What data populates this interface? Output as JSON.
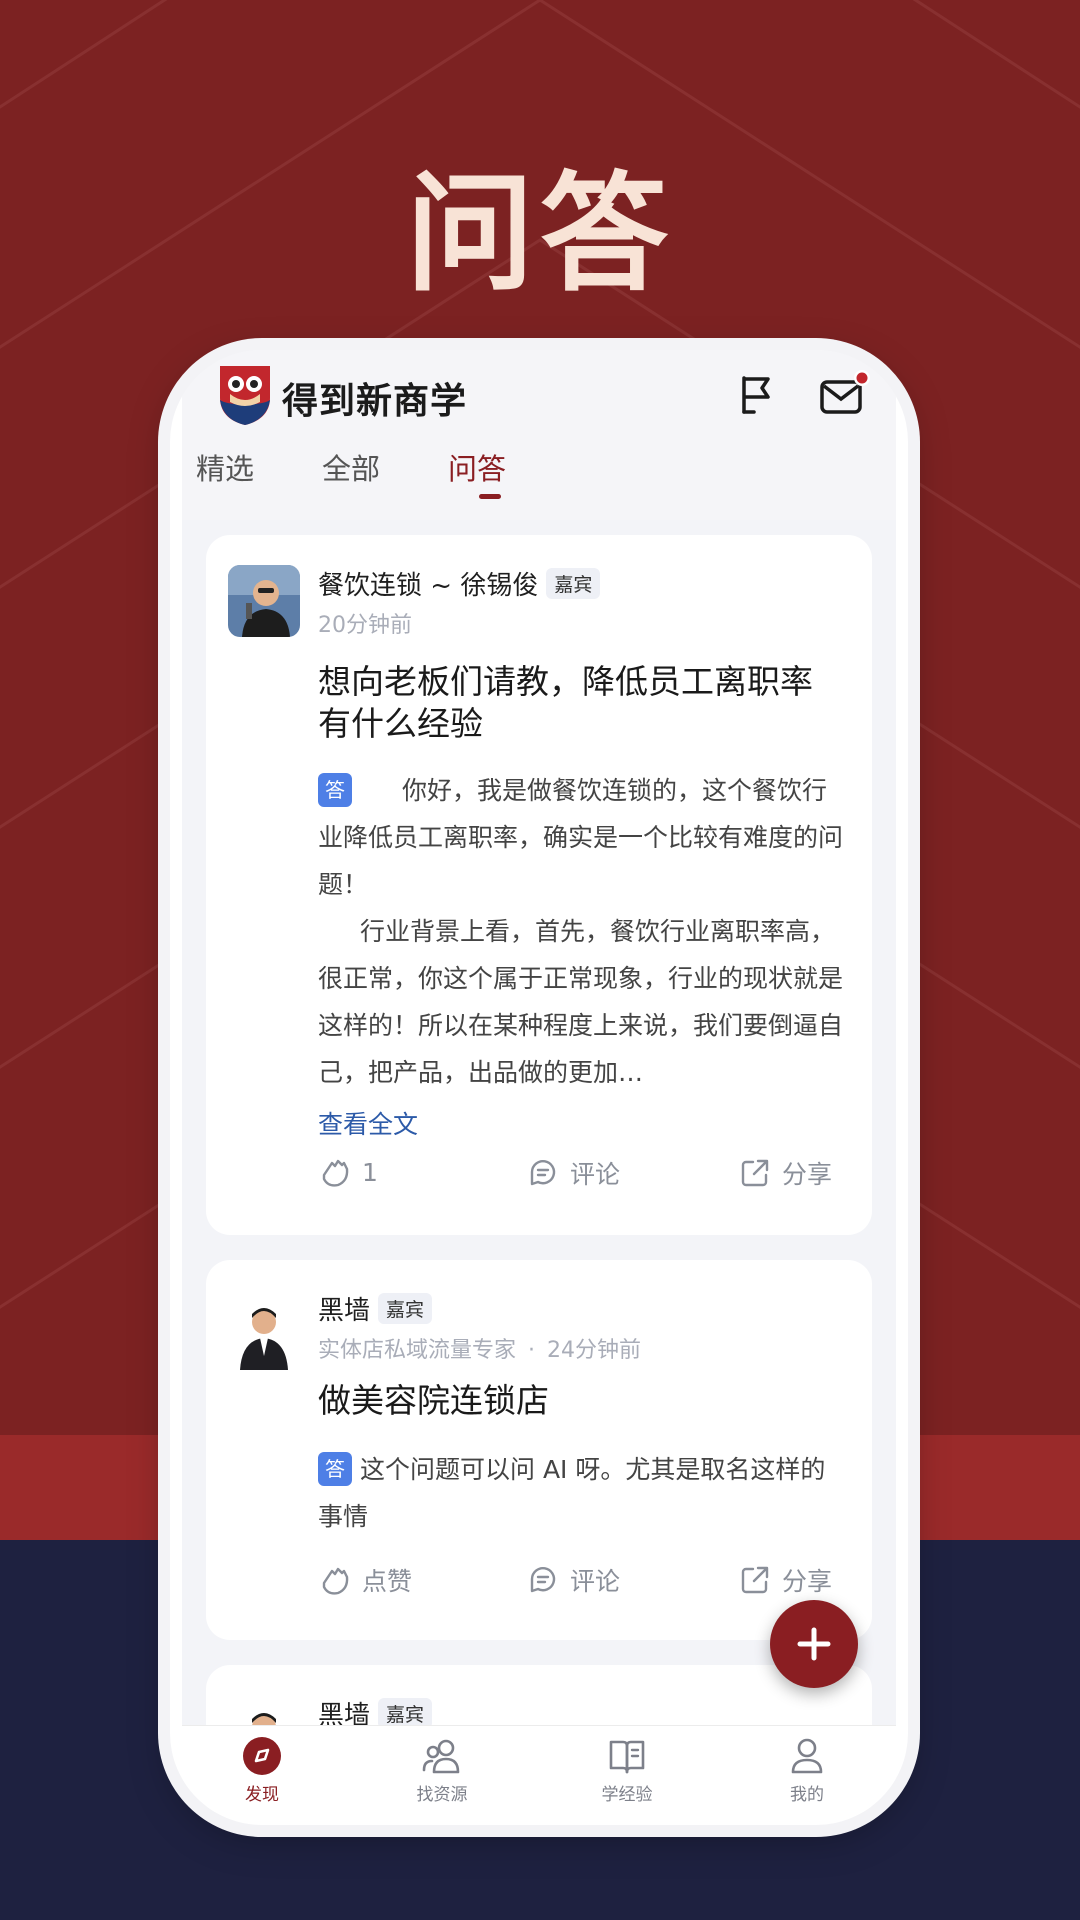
{
  "headline": "问答",
  "app": {
    "title": "得到新商学",
    "tabs": [
      {
        "label": "精选"
      },
      {
        "label": "全部"
      },
      {
        "label": "问答"
      }
    ]
  },
  "posts": [
    {
      "author": "餐饮连锁 ~ 徐锡俊",
      "badge": "嘉宾",
      "time": "20分钟前",
      "title": "想向老板们请教，降低员工离职率有什么经验",
      "answer_tag": "答",
      "answer_p1": "你好，我是做餐饮连锁的，这个餐饮行业降低员工离职率，确实是一个比较有难度的问题！",
      "answer_p2": "行业背景上看，首先，餐饮行业离职率高，很正常，你这个属于正常现象，行业的现状就是这样的！所以在某种程度上来说，我们要倒逼自己，把产品，出品做的更加…",
      "read_more": "查看全文",
      "like": "1",
      "comment": "评论",
      "share": "分享"
    },
    {
      "author": "黑墙",
      "badge": "嘉宾",
      "subtitle": "实体店私域流量专家",
      "time": "24分钟前",
      "title": "做美容院连锁店",
      "answer_tag": "答",
      "answer": "这个问题可以问 AI 呀。尤其是取名这样的事情",
      "like": "点赞",
      "comment": "评论",
      "share": "分享"
    },
    {
      "author": "黑墙",
      "badge": "嘉宾"
    }
  ],
  "bottom_nav": [
    {
      "label": "发现",
      "icon": "compass-icon"
    },
    {
      "label": "找资源",
      "icon": "people-icon"
    },
    {
      "label": "学经验",
      "icon": "book-icon"
    },
    {
      "label": "我的",
      "icon": "person-icon"
    }
  ],
  "colors": {
    "brand": "#8a1e22",
    "answer_tag": "#4e7fe6",
    "link": "#2c5aa8"
  }
}
